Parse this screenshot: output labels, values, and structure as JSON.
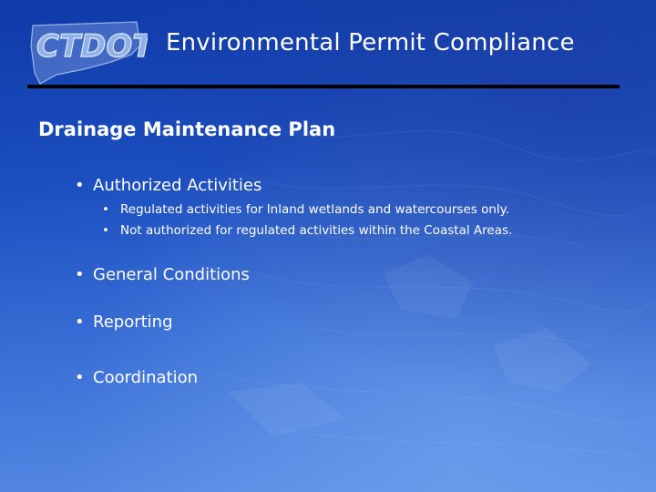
{
  "header": {
    "logo_text": "CTDOT",
    "title": "Environmental Permit Compliance"
  },
  "slide": {
    "subtitle": "Drainage Maintenance Plan",
    "bullets": [
      {
        "label": "Authorized Activities",
        "sub": [
          "Regulated activities for Inland wetlands and watercourses only.",
          "Not authorized for regulated activities within the Coastal Areas."
        ]
      },
      {
        "label": "General Conditions"
      },
      {
        "label": "Reporting"
      },
      {
        "label": "Coordination"
      }
    ],
    "bullet_glyph": "•"
  },
  "colors": {
    "background_top": "#0f3aa8",
    "background_bottom": "#5c8fe6",
    "text": "#ffffff",
    "rule": "#000000",
    "logo_fill": "#8fb0e8"
  }
}
